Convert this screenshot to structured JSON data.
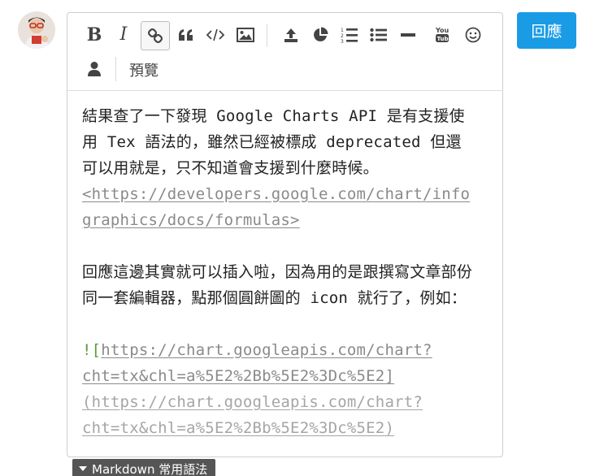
{
  "toolbar": {
    "bold_label": "B",
    "italic_label": "I",
    "preview_label": "預覽"
  },
  "reply_button_label": "回應",
  "markdown_help_label": "Markdown 常用語法",
  "content": {
    "para1_line1": "結果查了一下發現 Google Charts API 是有支援使",
    "para1_line2": "用 Tex 語法的，雖然已經被標成 deprecated 但還",
    "para1_line3": "可以用就是，只不知道會支援到什麼時候。",
    "link1_line1": "<https://developers.google.com/chart/info",
    "link1_line2": "graphics/docs/formulas>",
    "para2_line1": "回應這邊其實就可以插入啦，因為用的是跟撰寫文章部份",
    "para2_line2": "同一套編輯器，點那個圓餅圖的 icon 就行了，例如：",
    "img_bang": "!",
    "img_open": "[",
    "img_alt_line1": "https://chart.googleapis.com/chart?",
    "img_alt_line2": "cht=tx&chl=a%5E2%2Bb%5E2%3Dc%5E2]",
    "img_url_line1": "(https://chart.googleapis.com/chart?",
    "img_url_line2": "cht=tx&chl=a%5E2%2Bb%5E2%3Dc%5E2)"
  },
  "icons": [
    "bold-icon",
    "italic-icon",
    "link-icon",
    "quote-icon",
    "code-icon",
    "image-icon",
    "upload-icon",
    "pie-chart-icon",
    "ordered-list-icon",
    "unordered-list-icon",
    "horizontal-rule-icon",
    "youtube-icon",
    "emoji-icon",
    "user-icon"
  ],
  "colors": {
    "reply_button": "#1a9be6",
    "markdown_help_bg": "#555555",
    "link_text": "#8a8a8a",
    "image_bang": "#5a9a3a"
  }
}
